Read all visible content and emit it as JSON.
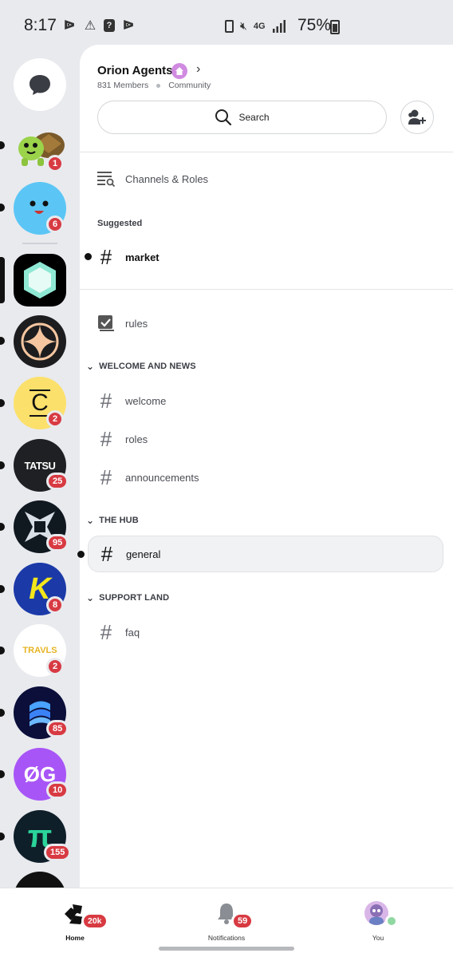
{
  "status_bar": {
    "time": "8:17",
    "battery": "75%",
    "network": "4G"
  },
  "rail": {
    "items": [
      {
        "name": "direct-messages",
        "badge": ""
      },
      {
        "name": "turtle-server",
        "badge": "1"
      },
      {
        "name": "blue-face-server",
        "badge": "6"
      },
      {
        "name": "hexagon-server",
        "badge": ""
      },
      {
        "name": "compass-server",
        "badge": ""
      },
      {
        "name": "c-server",
        "badge": "2",
        "letter": "C"
      },
      {
        "name": "tatsu-server",
        "badge": "25",
        "letter": "TATSU"
      },
      {
        "name": "star-server",
        "badge": "95"
      },
      {
        "name": "k-server",
        "badge": "8",
        "letter": "K"
      },
      {
        "name": "travls-server",
        "badge": "2",
        "letter": "TRAVLS"
      },
      {
        "name": "wave-server",
        "badge": "85"
      },
      {
        "name": "og-server",
        "badge": "10",
        "letter": "ØG"
      },
      {
        "name": "pi-server",
        "badge": "155",
        "letter": "π"
      }
    ]
  },
  "server": {
    "name": "Orion Agents",
    "members": "831 Members",
    "type": "Community",
    "search_label": "Search"
  },
  "channels_roles_label": "Channels & Roles",
  "suggested": {
    "label": "Suggested",
    "channels": [
      {
        "name": "market"
      }
    ]
  },
  "rules_channel": "rules",
  "categories": [
    {
      "name": "WELCOME AND NEWS",
      "channels": [
        "welcome",
        "roles",
        "announcements"
      ]
    },
    {
      "name": "THE HUB",
      "channels": [
        "general"
      ]
    },
    {
      "name": "SUPPORT LAND",
      "channels": [
        "faq"
      ]
    }
  ],
  "bottom_nav": {
    "home": {
      "label": "Home",
      "badge": "20k"
    },
    "notifications": {
      "label": "Notifications",
      "badge": "59"
    },
    "you": {
      "label": "You"
    }
  },
  "colors": {
    "badge": "#d83a42",
    "rail_bg": "#e9eaee",
    "online": "#8fd8a2"
  }
}
